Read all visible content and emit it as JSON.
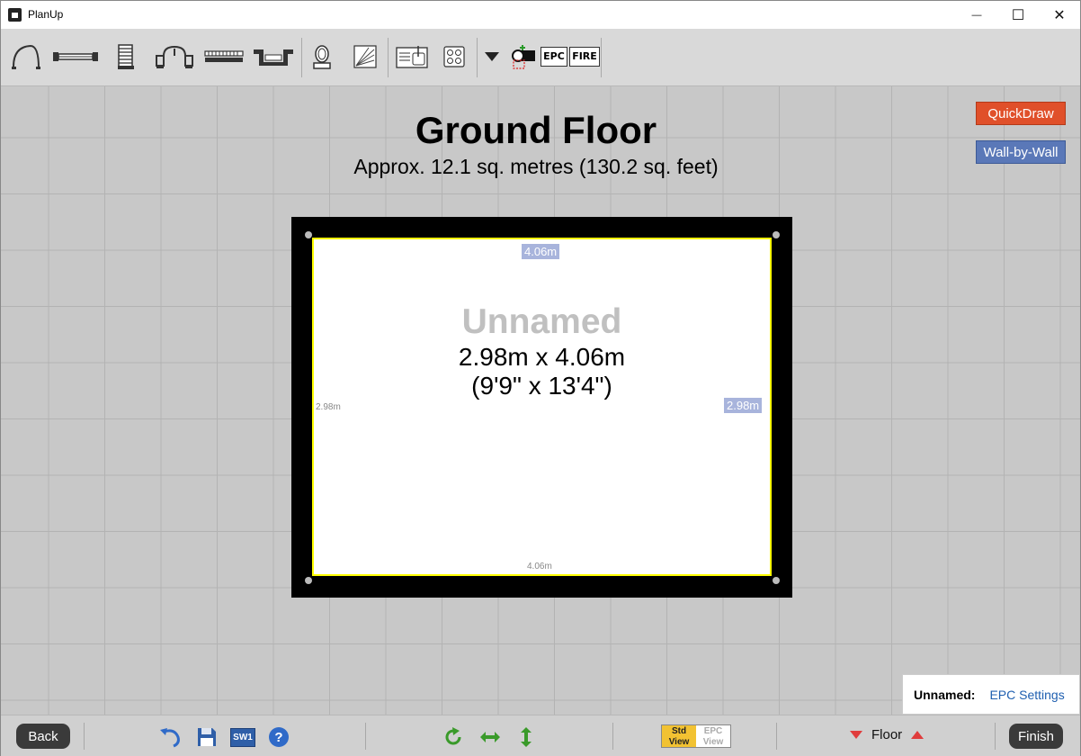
{
  "window": {
    "title": "PlanUp",
    "minimize_glyph": "—",
    "maximize_glyph": "☐",
    "close_glyph": "✕"
  },
  "toolbar": {
    "tools": [
      "door-icon",
      "window-icon",
      "stairs-icon",
      "opening-icon",
      "radiator-icon",
      "bay-window-icon",
      "toilet-icon",
      "shower-icon",
      "kitchen-unit-icon",
      "hob-icon",
      "dropdown-icon",
      "camera-icon"
    ],
    "epc_label": "EPC",
    "fire_label": "FIRE"
  },
  "canvas": {
    "floor_title": "Ground Floor",
    "floor_area": "Approx. 12.1 sq. metres (130.2 sq. feet)",
    "quickdraw_label": "QuickDraw",
    "wall_by_wall_label": "Wall-by-Wall",
    "room": {
      "name": "Unnamed",
      "dims_metric": "2.98m x 4.06m",
      "dims_imperial": "(9'9\" x 13'4\")",
      "dim_top": "4.06m",
      "dim_bottom": "4.06m",
      "dim_left": "2.98m",
      "dim_right": "2.98m"
    }
  },
  "epc_panel": {
    "label": "Unnamed:",
    "link": "EPC Settings"
  },
  "bottombar": {
    "back_label": "Back",
    "finish_label": "Finish",
    "sw1_label": "SW1",
    "help_label": "?",
    "std_view_line1": "Std",
    "std_view_line2": "View",
    "epc_view_line1": "EPC",
    "epc_view_line2": "View",
    "floor_label": "Floor"
  },
  "colors": {
    "quickdraw": "#e0502a",
    "wall_by_wall": "#5a78b8",
    "room_border": "#ffff00",
    "std_view": "#f2c232"
  }
}
